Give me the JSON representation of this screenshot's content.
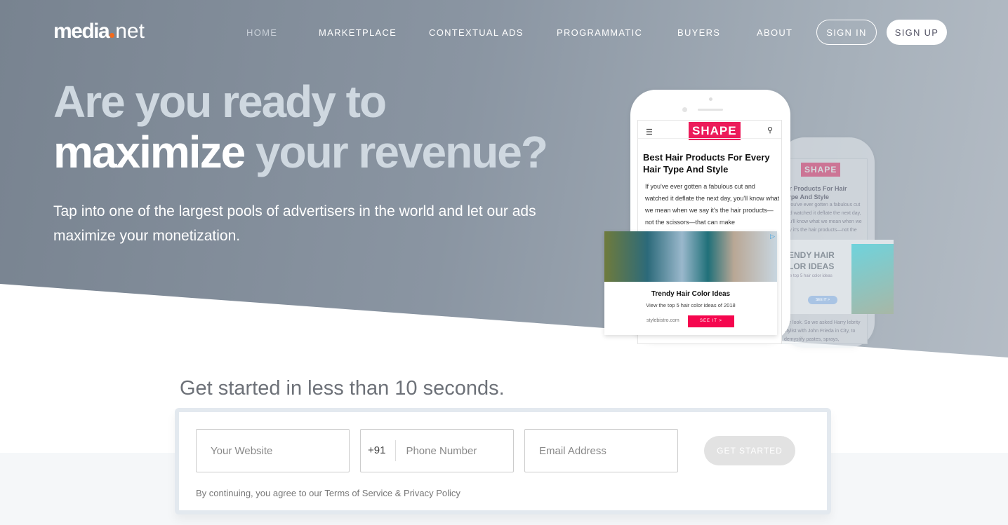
{
  "header": {
    "logo": "media.net",
    "nav": [
      "HOME",
      "MARKETPLACE",
      "CONTEXTUAL ADS",
      "PROGRAMMATIC",
      "BUYERS",
      "ABOUT"
    ],
    "sign_in": "SIGN IN",
    "sign_up": "SIGN UP"
  },
  "hero": {
    "line1": "Are you ready to",
    "line2_bold": "maximize",
    "line2_rest": " your revenue?",
    "subtitle": "Tap into one of the largest pools of advertisers in the world and let our ads maximize your monetization."
  },
  "mockup": {
    "brand": "SHAPE",
    "article_title": "Best Hair Products For Every Hair Type And Style",
    "article_body": "If you've ever gotten a fabulous cut and watched it deflate the next day, you'll know what we mean when we say it's the hair products—not the scissors—that can make",
    "back_article_title": "air Products For Hair Type And Style",
    "ad_title": "Trendy Hair Color Ideas",
    "ad_sub": "View the top 5 hair color ideas of 2018",
    "ad_source": "stylebistro.com",
    "ad_cta": "SEE IT  >",
    "back_ad_title": "ENDY HAIR LOR IDEAS",
    "back_ad_sub": "e top 5 hair color ideas",
    "back_ad_cta": "SEE IT  >",
    "back_body": "our look. So we asked Harry lebrity stylist with John Frieda in City, to demystify pastes, sprays,"
  },
  "form": {
    "title": "Get started in less than 10 seconds.",
    "website_placeholder": "Your Website",
    "country_code": "+91",
    "phone_placeholder": "Phone Number",
    "email_placeholder": "Email Address",
    "cta": "GET STARTED",
    "terms": "By continuing, you agree to our Terms of Service & Privacy Policy"
  },
  "colors": {
    "accent": "#ec1b5a",
    "logo_dot": "#f26a1b"
  }
}
